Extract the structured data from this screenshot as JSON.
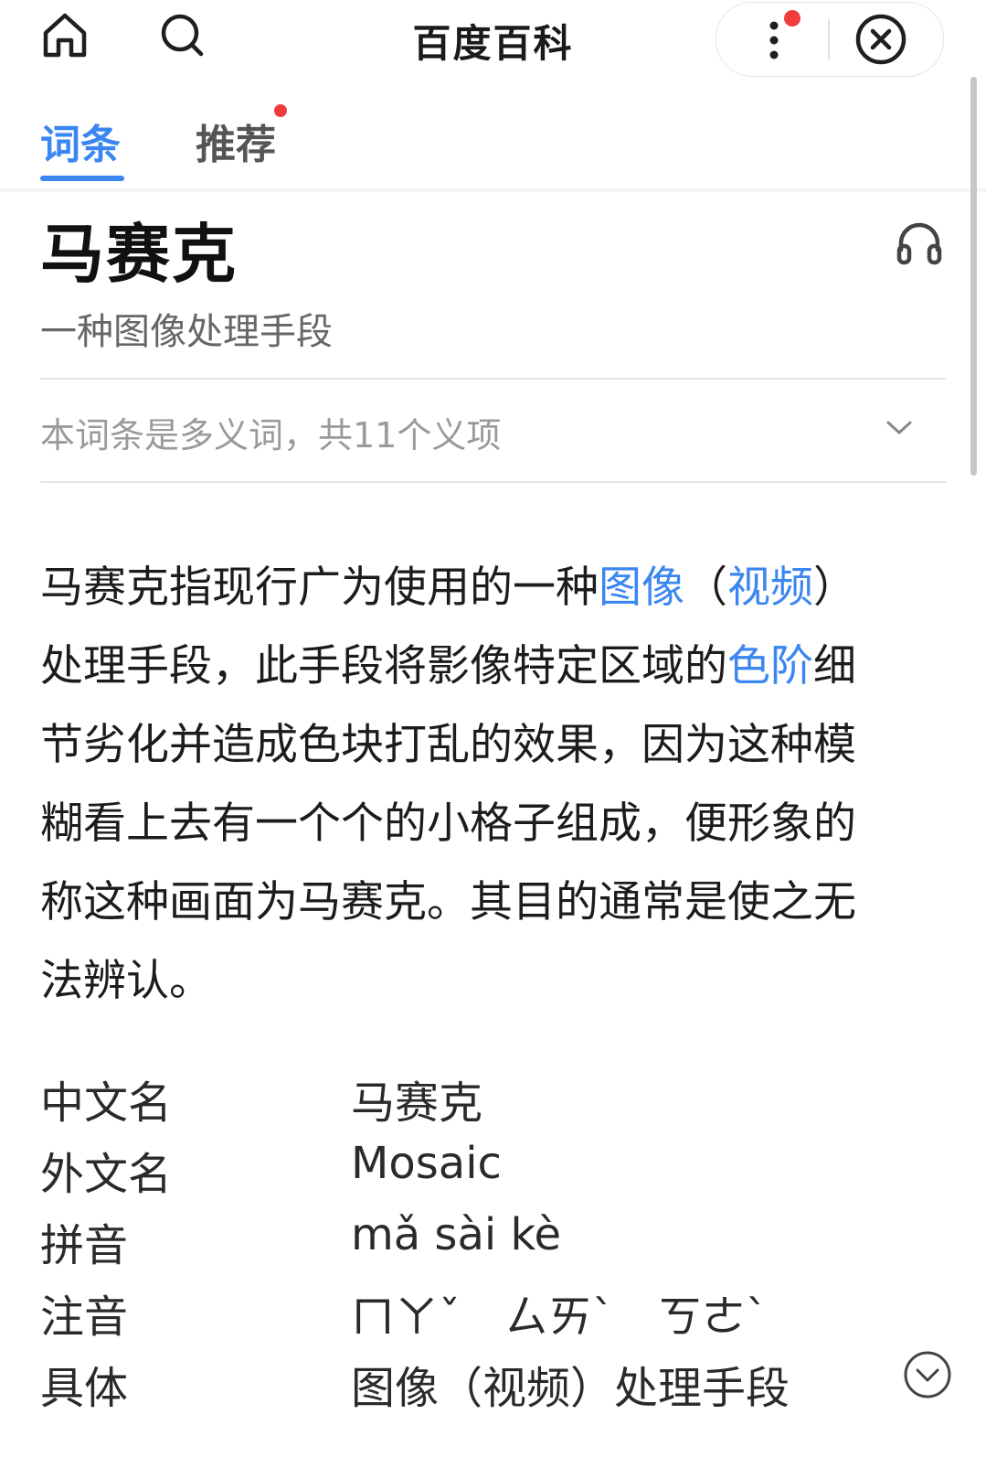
{
  "header": {
    "title": "百度百科"
  },
  "tabs": [
    {
      "label": "词条",
      "active": true
    },
    {
      "label": "推荐",
      "badge": true
    }
  ],
  "entry": {
    "term": "马赛克",
    "subtitle": "一种图像处理手段",
    "polysemy_note": "本词条是多义词，共11个义项"
  },
  "summary": {
    "l1_a": "马赛克指现行广为使用的一种",
    "l1_link1": "图像",
    "l1_b": "（",
    "l1_link2": "视频",
    "l1_c": "）",
    "l2_a": "处理手段，此手段将影像特定区域的",
    "l2_link": "色阶",
    "l2_b": "细",
    "l3": "节劣化并造成色块打乱的效果，因为这种模",
    "l4": "糊看上去有一个个的小格子组成，便形象的",
    "l5": "称这种画面为马赛克。其目的通常是使之无",
    "l6": "法辨认。"
  },
  "basic_info": [
    {
      "label": "中文名",
      "value": "马赛克"
    },
    {
      "label": "外文名",
      "value": "Mosaic"
    },
    {
      "label": "拼音",
      "value": "mǎ sài kè"
    },
    {
      "label": "注音",
      "value": "ㄇㄚˇ　ㄙㄞˋ　ㄎㄜˋ"
    },
    {
      "label": "具体",
      "value": "图像（视频）处理手段"
    }
  ],
  "colors": {
    "accent": "#3b86f0",
    "badge": "#f03c3c"
  },
  "icons": [
    "home-icon",
    "search-icon",
    "more-vertical-icon",
    "close-circle-icon",
    "headphones-icon",
    "chevron-down-icon",
    "expand-circle-icon"
  ]
}
